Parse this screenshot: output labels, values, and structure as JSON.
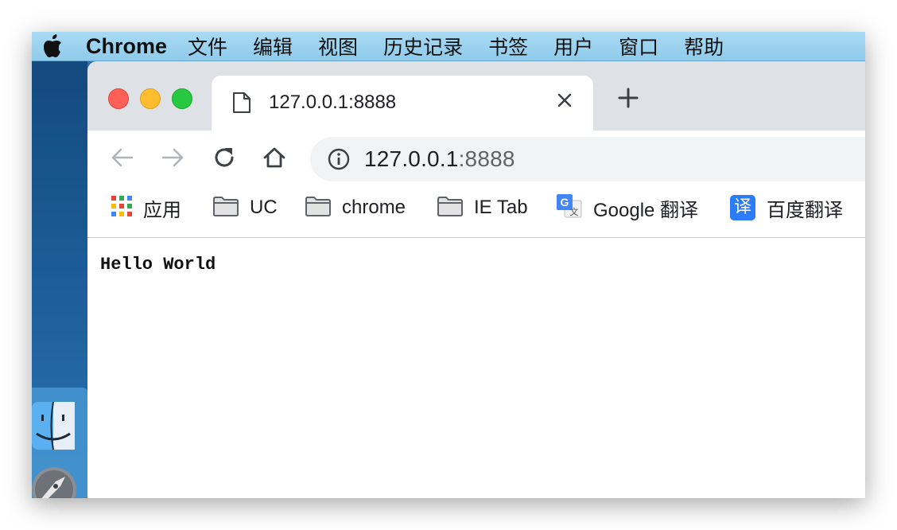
{
  "menubar": {
    "app_name": "Chrome",
    "items": [
      "文件",
      "编辑",
      "视图",
      "历史记录",
      "书签",
      "用户",
      "窗口",
      "帮助"
    ]
  },
  "tab": {
    "title": "127.0.0.1:8888"
  },
  "address": {
    "host": "127.0.0.1",
    "port": ":8888"
  },
  "bookmarks": [
    {
      "label": "应用",
      "icon": "apps-grid-icon"
    },
    {
      "label": "UC",
      "icon": "folder-icon"
    },
    {
      "label": "chrome",
      "icon": "folder-icon"
    },
    {
      "label": "IE Tab",
      "icon": "folder-icon"
    },
    {
      "label": "Google 翻译",
      "icon": "google-translate-icon"
    },
    {
      "label": "百度翻译",
      "icon": "baidu-translate-icon"
    }
  ],
  "baidu_icon_char": "译",
  "page": {
    "body_text": "Hello World"
  },
  "colors": {
    "traffic_red": "#fe5f57",
    "traffic_yellow": "#febc2e",
    "traffic_green": "#28c840",
    "tab_strip": "#dee1e6",
    "omnibox": "#f1f3f4"
  }
}
